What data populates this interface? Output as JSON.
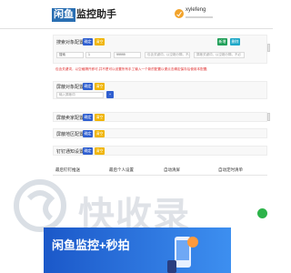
{
  "header": {
    "brand_badge": "闲鱼",
    "brand_text": "监控助手",
    "user_name": "xylefeng",
    "user_sub": "xxxxxxxxxxxxxxx"
  },
  "panel_keyword": {
    "title": "搜索对象配置",
    "confirm_label": "确定",
    "clear_label": "清空",
    "add_label": "新增",
    "delete_label": "删除",
    "keyword_value": "搜索",
    "min_price": "1",
    "max_price": "99999",
    "include_placeholder": "包含关键词，以空格分隔，不必",
    "exclude_placeholder": "屏蔽关键词，以空格分隔，不必"
  },
  "warning_text": "包含关键词，以空格隔开即可,并不是可以设置所有手工输入一个新的配置以便点击确定保存后使用本配置;",
  "panel_block": {
    "title": "屏蔽对象配置",
    "confirm_label": "确定",
    "clear_label": "清空",
    "input_placeholder": "输入屏蔽词",
    "add_label": "+"
  },
  "panel_seller": {
    "title": "屏蔽卖家配置",
    "confirm_label": "确定",
    "clear_label": "清空"
  },
  "panel_region": {
    "title": "屏蔽地区配置",
    "confirm_label": "确定",
    "clear_label": "清空"
  },
  "panel_subscribe": {
    "title": "钉钉通知设置",
    "confirm_label": "确定",
    "clear_label": "清空"
  },
  "columns": [
    "最后钉钉推送",
    "最后个人设置",
    "自动清屏",
    "自动定时清单"
  ],
  "watermark_text": "快收录",
  "banner": {
    "title": "闲鱼监控+秒拍"
  }
}
